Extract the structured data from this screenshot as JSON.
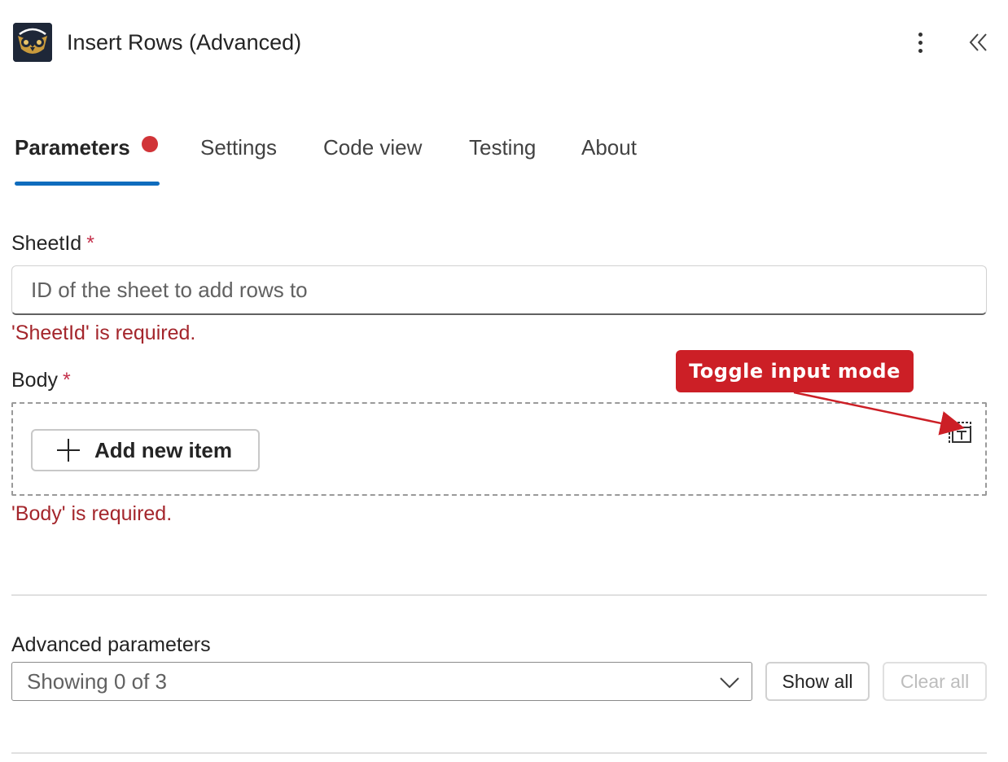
{
  "header": {
    "title": "Insert Rows (Advanced)",
    "icon": "owl-logo-icon",
    "more_icon": "more-vertical-icon",
    "collapse_icon": "double-chevron-left-icon"
  },
  "tabs": [
    {
      "label": "Parameters",
      "active": true,
      "has_error_dot": true
    },
    {
      "label": "Settings",
      "active": false
    },
    {
      "label": "Code view",
      "active": false
    },
    {
      "label": "Testing",
      "active": false
    },
    {
      "label": "About",
      "active": false
    }
  ],
  "sheet_id": {
    "label": "SheetId",
    "required_marker": "*",
    "placeholder": "ID of the sheet to add rows to",
    "value": "",
    "error": "'SheetId' is required."
  },
  "body": {
    "label": "Body",
    "required_marker": "*",
    "add_button_label": "Add new item",
    "toggle_icon": "toggle-input-mode-icon",
    "error": "'Body' is required."
  },
  "annotation": {
    "label": "Toggle input mode",
    "color": "#cc1f26"
  },
  "advanced": {
    "label": "Advanced parameters",
    "dropdown_value": "Showing 0 of 3",
    "show_all_label": "Show all",
    "clear_all_label": "Clear all",
    "clear_all_disabled": true
  },
  "colors": {
    "accent": "#0f6cbd",
    "error_dot": "#d13438",
    "error_text": "#a4262c"
  }
}
